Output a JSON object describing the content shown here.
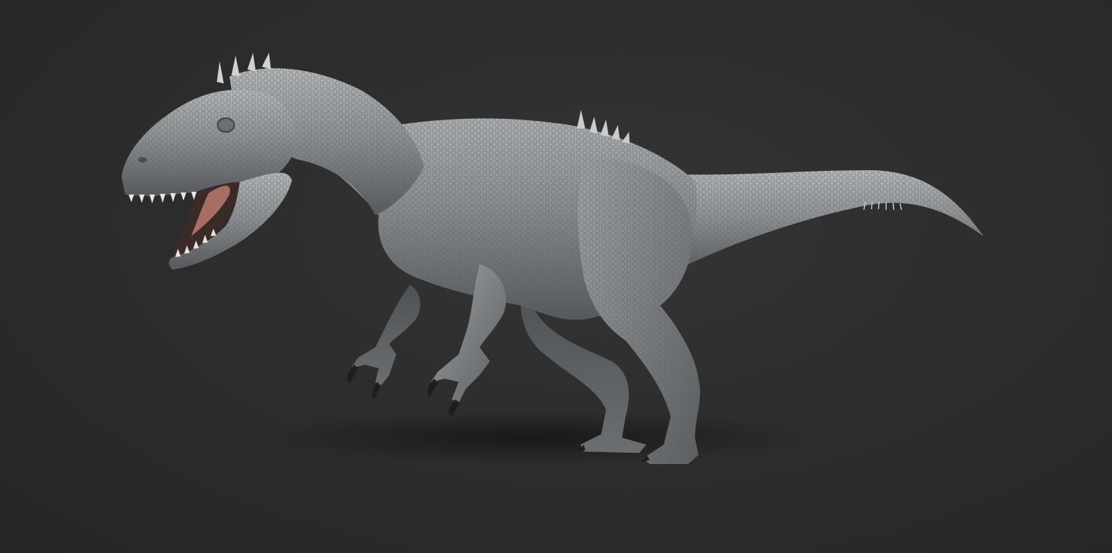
{
  "scene": {
    "subject": "dinosaur-sculpt",
    "colors": {
      "background": "#2b2b2b",
      "background_light": "#353535",
      "skin_light": "#a9acae",
      "skin_mid": "#7f8385",
      "skin_dark": "#555859",
      "tongue": "#a86e66",
      "mouth_dark": "#3a2a28",
      "teeth": "#e4e4e0",
      "claws": "#1c1f1f",
      "shadow": "#1a1a1a"
    }
  }
}
